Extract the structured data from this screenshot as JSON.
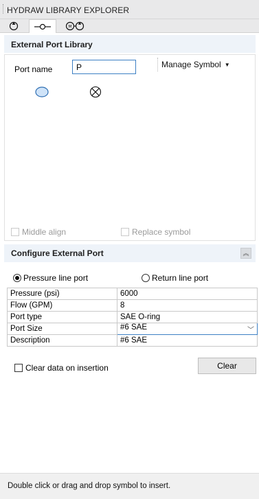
{
  "window": {
    "title": "HYDRAW LIBRARY EXPLORER"
  },
  "tabs": [
    {
      "icon": "pump-icon",
      "active": false
    },
    {
      "icon": "port-line-icon",
      "active": true
    },
    {
      "icon": "motor-pump-icon",
      "active": false
    }
  ],
  "library": {
    "header": "External Port Library",
    "port_name_label": "Port name",
    "port_name_value": "P",
    "manage_symbol_label": "Manage Symbol",
    "symbols": [
      "circle-port-symbol",
      "cross-circle-port-symbol"
    ],
    "middle_align_label": "Middle align",
    "replace_symbol_label": "Replace symbol"
  },
  "configure": {
    "header": "Configure External Port",
    "pressure_port_label": "Pressure line port",
    "return_port_label": "Return line port",
    "selected_port": "pressure",
    "rows": [
      {
        "key": "Pressure (psi)",
        "value": "6000"
      },
      {
        "key": "Flow (GPM)",
        "value": "8"
      },
      {
        "key": "Port type",
        "value": "SAE O-ring"
      },
      {
        "key": "Port Size",
        "value": "#6 SAE"
      },
      {
        "key": "Description",
        "value": "#6 SAE"
      }
    ],
    "clear_on_insert_label": "Clear data on insertion",
    "clear_button_label": "Clear"
  },
  "footer": {
    "hint": "Double click or drag and drop symbol to insert."
  },
  "colors": {
    "accent": "#3c7fc4",
    "section_header": "#eef3f9",
    "symbol_fill": "#cfe3f8"
  }
}
